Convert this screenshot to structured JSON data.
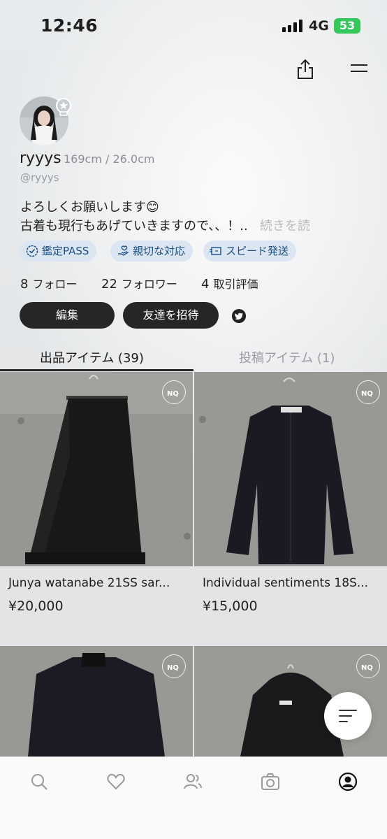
{
  "status_bar": {
    "time": "12:46",
    "network": "4G",
    "battery": "53"
  },
  "profile": {
    "username": "ryyys",
    "size": "169cm / 26.0cm",
    "handle": "@ryyys",
    "bio_line1": "よろしくお願いします😊",
    "bio_line2": "古着も現行もあげていきますので、、！..",
    "bio_more": "続きを読",
    "tags": [
      "鑑定PASS",
      "親切な対応",
      "スピード発送"
    ],
    "stats": [
      {
        "value": "8",
        "label": "フォロー"
      },
      {
        "value": "22",
        "label": "フォロワー"
      },
      {
        "value": "4",
        "label": "取引評価"
      }
    ],
    "buttons": {
      "edit": "編集",
      "invite": "友達を招待"
    }
  },
  "tabs": [
    {
      "label": "出品アイテム (39)",
      "active": true
    },
    {
      "label": "投稿アイテム (1)",
      "active": false
    }
  ],
  "items": [
    {
      "title": "Junya watanabe 21SS sar...",
      "price": "¥20,000",
      "badge": "NQ"
    },
    {
      "title": "Individual sentiments 18S...",
      "price": "¥15,000",
      "badge": "NQ"
    },
    {
      "title": "",
      "price": "",
      "badge": "NQ"
    },
    {
      "title": "",
      "price": "",
      "badge": "NQ"
    }
  ],
  "nav": [
    "search-icon",
    "heart-icon",
    "people-icon",
    "camera-icon",
    "profile-icon"
  ],
  "colors": {
    "tag_bg": "#dbe6f2",
    "tag_text": "#1c4f86",
    "button_dark": "#262626",
    "battery": "#34c759"
  }
}
